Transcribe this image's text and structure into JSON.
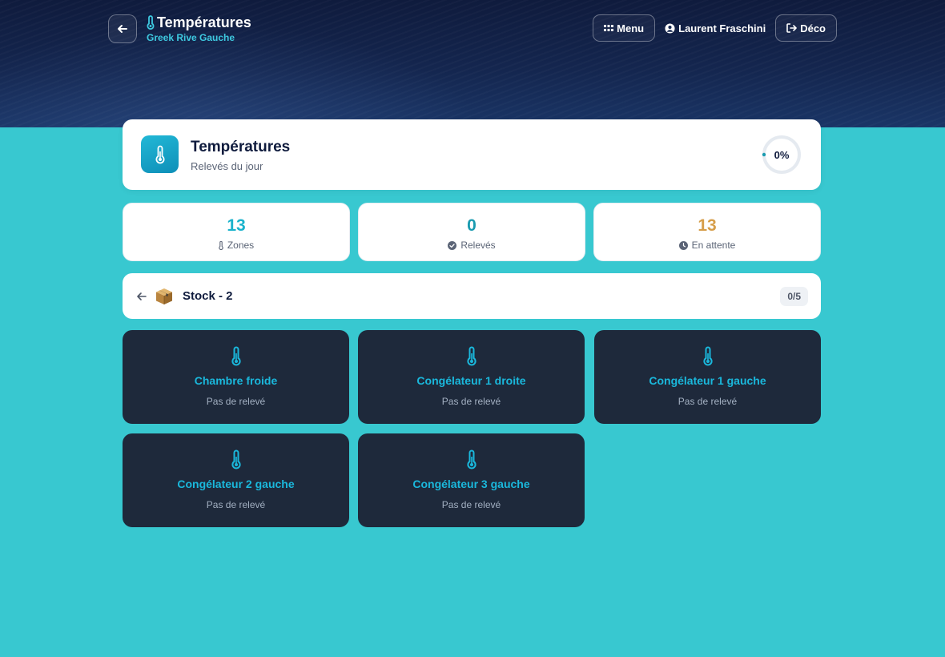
{
  "header": {
    "title": "Températures",
    "subtitle": "Greek Rive Gauche",
    "menu_label": "Menu",
    "user_name": "Laurent Fraschini",
    "logout_label": "Déco"
  },
  "summary": {
    "title": "Températures",
    "subtitle": "Relevés du jour",
    "progress_label": "0%",
    "progress": 0
  },
  "stats": [
    {
      "value": "13",
      "label": "Zones",
      "icon": "thermometer-icon",
      "color": "#1ab3cc"
    },
    {
      "value": "0",
      "label": "Relevés",
      "icon": "check-circle-icon",
      "color": "#1a9bb0"
    },
    {
      "value": "13",
      "label": "En attente",
      "icon": "clock-icon",
      "color": "#d69e4a"
    }
  ],
  "stock": {
    "icon": "box-icon",
    "title": "Stock - 2",
    "count": "0/5"
  },
  "zones": [
    {
      "name": "Chambre froide",
      "status": "Pas de relevé"
    },
    {
      "name": "Congélateur 1 droite",
      "status": "Pas de relevé"
    },
    {
      "name": "Congélateur 1 gauche",
      "status": "Pas de relevé"
    },
    {
      "name": "Congélateur 2 gauche",
      "status": "Pas de relevé"
    },
    {
      "name": "Congélateur 3 gauche",
      "status": "Pas de relevé"
    }
  ],
  "colors": {
    "accent": "#1ab8dc",
    "background": "#38c8d0",
    "hero": "#0f1b3d",
    "zone_card": "#1e293b"
  }
}
